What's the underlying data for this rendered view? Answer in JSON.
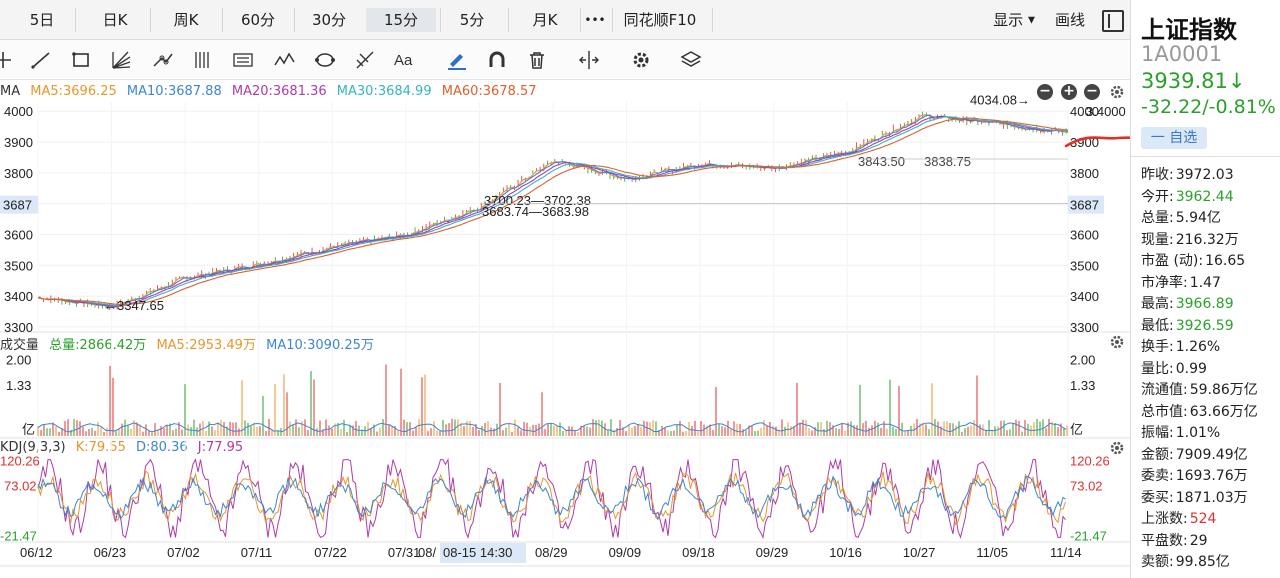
{
  "tabs": [
    "5日",
    "日K",
    "周K",
    "60分",
    "30分",
    "15分",
    "5分",
    "月K",
    "•••",
    "同花顺F10"
  ],
  "active_tab": "15分",
  "right_tools": {
    "display": "显示",
    "draw": "画线"
  },
  "ma_legend": [
    {
      "label": "MA",
      "color": "#333333"
    },
    {
      "label": "MA5:3696.25",
      "color": "#e8962a"
    },
    {
      "label": "MA10:3687.88",
      "color": "#3b86d6"
    },
    {
      "label": "MA20:3681.36",
      "color": "#b03aa8"
    },
    {
      "label": "MA30:3684.99",
      "color": "#34b4c8"
    },
    {
      "label": "MA60:3678.57",
      "color": "#e0602a"
    }
  ],
  "vol_legend": [
    {
      "label": "成交量",
      "color": "#333333"
    },
    {
      "label": "总量:2866.42万",
      "color": "#2aa02a"
    },
    {
      "label": "MA5:2953.49万",
      "color": "#e8962a"
    },
    {
      "label": "MA10:3090.25万",
      "color": "#3b86d6"
    }
  ],
  "kdj_legend": [
    {
      "label": "KDJ(9,3,3)",
      "color": "#333333"
    },
    {
      "label": "K:79.55",
      "color": "#e8962a"
    },
    {
      "label": "D:80.36",
      "color": "#3b86d6"
    },
    {
      "label": "J:77.95",
      "color": "#b03aa8"
    }
  ],
  "annotations": {
    "low": "←3347.65",
    "high": "4034.08→",
    "mid1": "3700.23—3702.38",
    "mid2": "3683.74—3683.98",
    "right1": "3843.50",
    "right2": "3838.75",
    "price_tag_left": "3687",
    "price_tag_right": "3687",
    "right_top": "3.4000",
    "crosshair_date": "08-15 14:30"
  },
  "info": {
    "name": "上证指数",
    "code": "1A0001",
    "price": "3939.81↓",
    "change": "-32.22/-0.81%",
    "fav": "一 自选",
    "stats": [
      {
        "k": "昨收:",
        "v": "3972.03",
        "c": ""
      },
      {
        "k": "今开:",
        "v": "3962.44",
        "c": "g"
      },
      {
        "k": "总量:",
        "v": "5.94亿",
        "c": ""
      },
      {
        "k": "现量:",
        "v": "216.32万",
        "c": ""
      },
      {
        "k": "市盈 (动):",
        "v": "16.65",
        "c": ""
      },
      {
        "k": "市净率:",
        "v": "1.47",
        "c": ""
      },
      {
        "k": "最高:",
        "v": "3966.89",
        "c": "g"
      },
      {
        "k": "最低:",
        "v": "3926.59",
        "c": "g"
      },
      {
        "k": "换手:",
        "v": "1.26%",
        "c": ""
      },
      {
        "k": "量比:",
        "v": "0.99",
        "c": ""
      },
      {
        "k": "流通值:",
        "v": "59.86万亿",
        "c": ""
      },
      {
        "k": "总市值:",
        "v": "63.66万亿",
        "c": ""
      },
      {
        "k": "振幅:",
        "v": "1.01%",
        "c": ""
      },
      {
        "k": "金额:",
        "v": "7909.49亿",
        "c": ""
      },
      {
        "k": "委卖:",
        "v": "1693.76万",
        "c": ""
      },
      {
        "k": "委买:",
        "v": "1871.03万",
        "c": ""
      },
      {
        "k": "上涨数:",
        "v": "524",
        "c": "r"
      },
      {
        "k": "平盘数:",
        "v": "29",
        "c": ""
      },
      {
        "k": "卖额:",
        "v": "99.85亿",
        "c": ""
      }
    ]
  },
  "chart_data": {
    "type": "line",
    "price": {
      "x": [
        "06/12",
        "06/23",
        "07/02",
        "07/11",
        "07/22",
        "07/31",
        "08/15",
        "08/29",
        "09/09",
        "09/18",
        "09/29",
        "10/16",
        "10/27",
        "11/05",
        "11/14"
      ],
      "close": [
        3395,
        3365,
        3460,
        3505,
        3560,
        3600,
        3690,
        3840,
        3780,
        3830,
        3815,
        3870,
        3985,
        3960,
        3930
      ],
      "y_ticks": [
        3300,
        3400,
        3500,
        3600,
        3700,
        3800,
        3900,
        4000
      ],
      "ylim": [
        3290,
        4030
      ],
      "low_mark": 3347.65,
      "high_mark": 4034.08
    },
    "volume": {
      "y_ticks_labels": [
        "2.00",
        "1.33",
        "亿"
      ],
      "ylim": [
        0,
        2.2
      ]
    },
    "kdj": {
      "y_ticks_labels": [
        "120.26",
        "73.02",
        "-21.47"
      ],
      "ylim": [
        -30,
        125
      ]
    }
  }
}
